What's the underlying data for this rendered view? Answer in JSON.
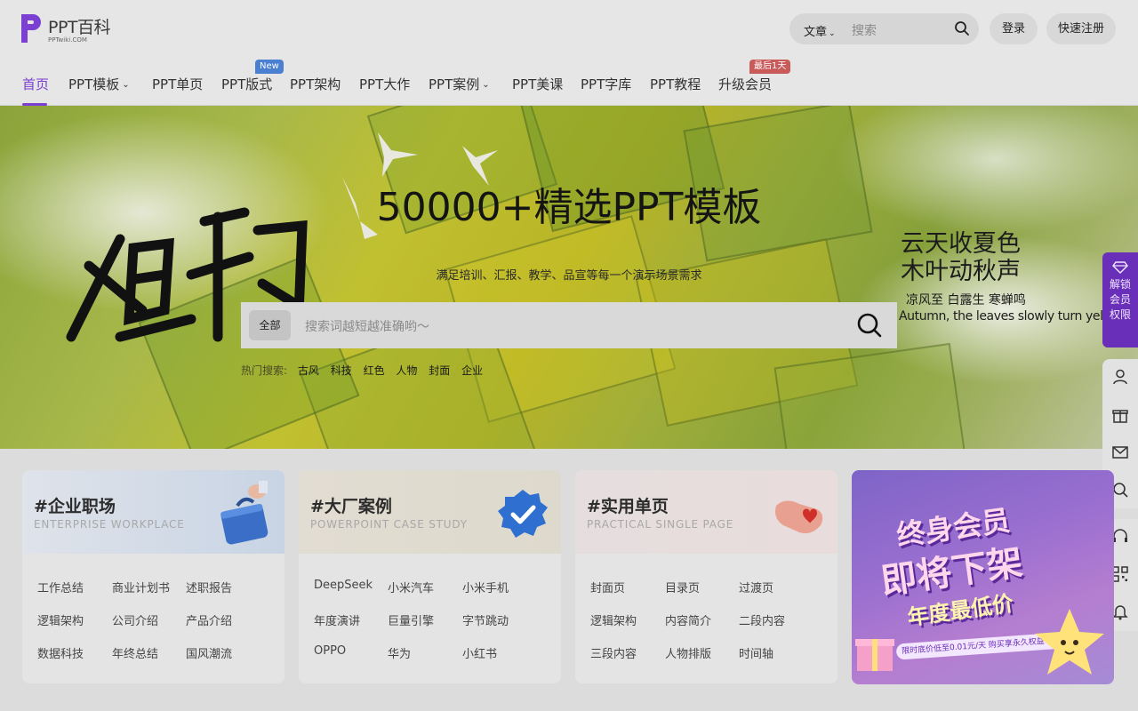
{
  "logo": {
    "title": "PPT百科",
    "sub": "PPTwiki.COM"
  },
  "header": {
    "search_category": "文章",
    "search_placeholder": "搜索",
    "login": "登录",
    "register": "快速注册"
  },
  "nav": {
    "items": [
      {
        "label": "首页"
      },
      {
        "label": "PPT模板"
      },
      {
        "label": "PPT单页"
      },
      {
        "label": "PPT版式"
      },
      {
        "label": "PPT架构"
      },
      {
        "label": "PPT大作"
      },
      {
        "label": "PPT案例"
      },
      {
        "label": "PPT美课"
      },
      {
        "label": "PPT字库"
      },
      {
        "label": "PPT教程"
      },
      {
        "label": "升级会员"
      }
    ],
    "badge_new": "New",
    "badge_last": "最后1天"
  },
  "hero": {
    "title": "50000+精选PPT模板",
    "subtitle": "满足培训、汇报、教学、品宣等每一个演示场景需求",
    "search_category": "全部",
    "search_placeholder": "搜索词越短越准确哟～",
    "hot_label": "热门搜索:",
    "hot_tags": [
      "古风",
      "科技",
      "红色",
      "人物",
      "封面",
      "企业"
    ],
    "poem_line1": "云天收夏色",
    "poem_line2": "木叶动秋声",
    "poem_terms": "凉风至  白露生  寒蝉鸣",
    "poem_en": "Autumn, the leaves slowly turn yellow."
  },
  "side": {
    "unlock": "解锁会员权限"
  },
  "cards": [
    {
      "title": "#企业职场",
      "sub": "ENTERPRISE WORKPLACE",
      "items": [
        "工作总结",
        "商业计划书",
        "述职报告",
        "逻辑架构",
        "公司介绍",
        "产品介绍",
        "数据科技",
        "年终总结",
        "国风潮流"
      ]
    },
    {
      "title": "#大厂案例",
      "sub": "POWERPOINT CASE STUDY",
      "items": [
        "DeepSeek",
        "小米汽车",
        "小米手机",
        "年度演讲",
        "巨量引擎",
        "字节跳动",
        "OPPO",
        "华为",
        "小红书"
      ]
    },
    {
      "title": "#实用单页",
      "sub": "PRACTICAL SINGLE PAGE",
      "items": [
        "封面页",
        "目录页",
        "过渡页",
        "逻辑架构",
        "内容简介",
        "二段内容",
        "三段内容",
        "人物排版",
        "时间轴"
      ]
    }
  ],
  "promo": {
    "line1": "终身会员",
    "line2": "即将下架",
    "line3": "年度最低价",
    "bar": "限时底价低至0.01元/天   购买享永久权益"
  },
  "colors": {
    "accent": "#7b3fd1",
    "unlock_bg": "#6a2fb8",
    "badge_new": "#4a7fd1",
    "badge_last": "#c95a5a"
  }
}
